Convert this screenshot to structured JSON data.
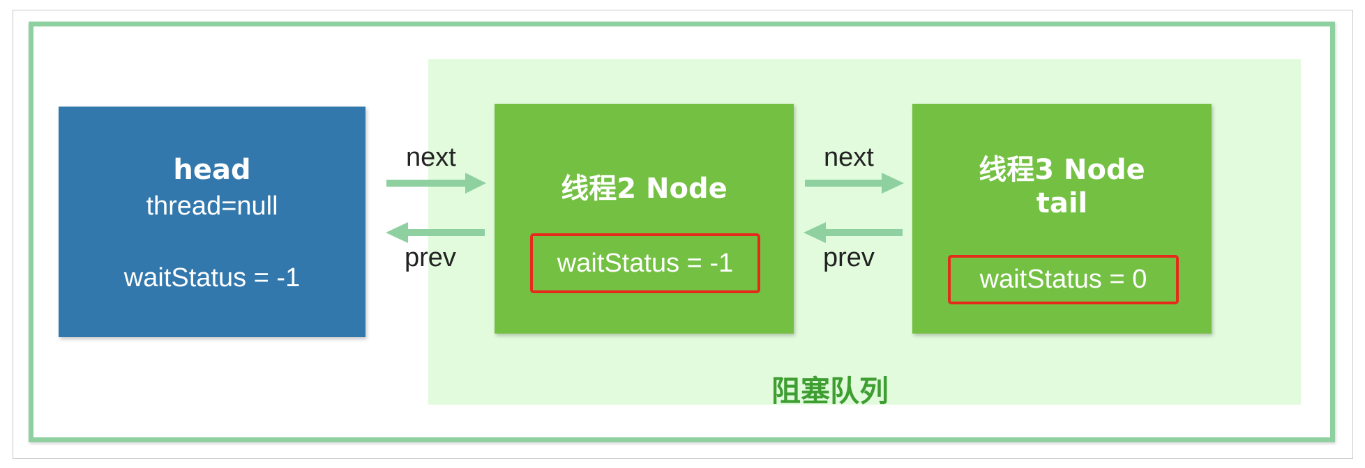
{
  "colors": {
    "frame_border": "#8fd0a0",
    "queue_background": "#e1fbdc",
    "head_node": "#3278ad",
    "thread_node": "#73c043",
    "arrow": "#8fd0a0",
    "status_highlight": "#e52a1b",
    "queue_label": "#3f9e32"
  },
  "head_node": {
    "title": "head",
    "thread": "thread=null",
    "wait_status": "waitStatus = -1"
  },
  "thread2_node": {
    "title": "线程2 Node",
    "wait_status": "waitStatus = -1"
  },
  "thread3_node": {
    "title": "线程3 Node",
    "subtitle": "tail",
    "wait_status": "waitStatus = 0"
  },
  "links": {
    "next_label": "next",
    "prev_label": "prev"
  },
  "queue": {
    "label": "阻塞队列"
  }
}
